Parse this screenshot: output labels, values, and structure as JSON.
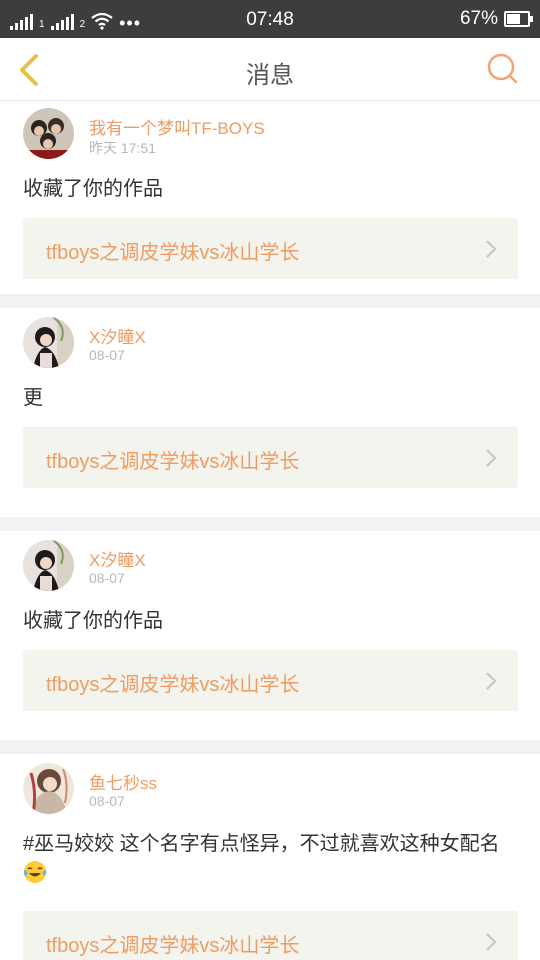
{
  "status_bar": {
    "network_1": "1",
    "network_2": "2",
    "time": "07:48",
    "battery_percent": "67%",
    "battery_level": 0.67,
    "icons": [
      "signal-icon",
      "signal-icon",
      "wifi-icon",
      "more-dots-icon",
      "battery-icon"
    ]
  },
  "nav": {
    "title": "消息",
    "back_icon": "chevron-left-icon",
    "search_icon": "search-icon"
  },
  "colors": {
    "accent": "#ef9c63",
    "back_arrow": "#e6c14a",
    "link_bg": "#f4f4ee",
    "gap_bg": "#f2f2f2"
  },
  "messages": [
    {
      "user": "我有一个梦叫TF-BOYS",
      "time": "昨天 17:51",
      "text": "收藏了你的作品",
      "link": "tfboys之调皮学妹vs冰山学长"
    },
    {
      "user": "X汐瞳X",
      "time": "08-07",
      "text": "更",
      "link": "tfboys之调皮学妹vs冰山学长"
    },
    {
      "user": "X汐瞳X",
      "time": "08-07",
      "text": "收藏了你的作品",
      "link": "tfboys之调皮学妹vs冰山学长"
    },
    {
      "user": "鱼七秒ss",
      "time": "08-07",
      "text": "#巫马姣姣 这个名字有点怪异，不过就喜欢这种女配名",
      "emoji": "laughing-tears-emoji",
      "link": "tfboys之调皮学妹vs冰山学长"
    }
  ]
}
